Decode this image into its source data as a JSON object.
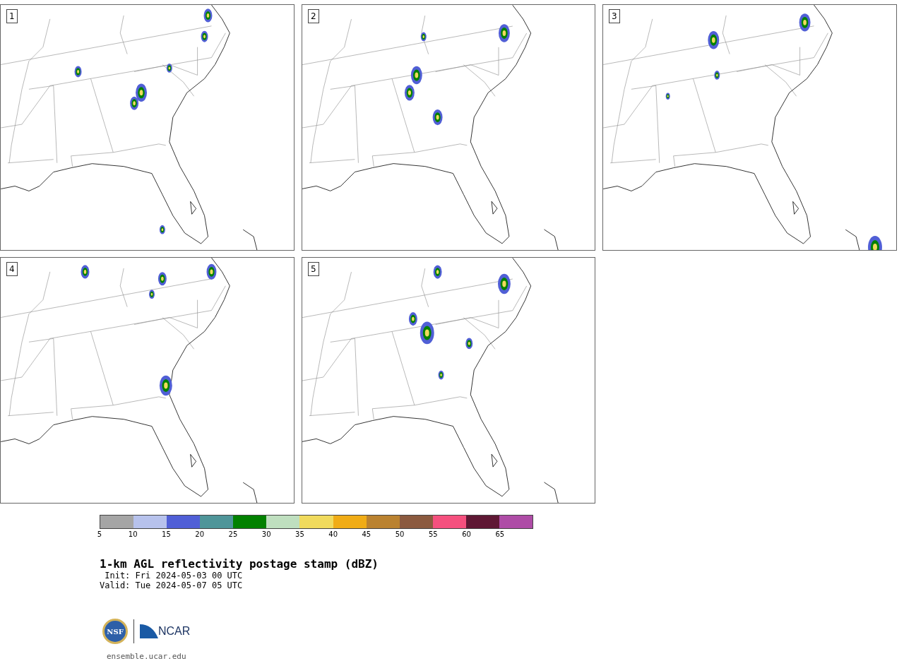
{
  "panels": [
    {
      "label": "1"
    },
    {
      "label": "2"
    },
    {
      "label": "3"
    },
    {
      "label": "4"
    },
    {
      "label": "5"
    }
  ],
  "colorbar": {
    "bins": [
      {
        "label": "5",
        "color": "#a5a5a5"
      },
      {
        "label": "10",
        "color": "#b7c2ec"
      },
      {
        "label": "15",
        "color": "#505fd6"
      },
      {
        "label": "20",
        "color": "#4f9599"
      },
      {
        "label": "25",
        "color": "#028100"
      },
      {
        "label": "30",
        "color": "#bfdfbf"
      },
      {
        "label": "35",
        "color": "#f0da5d"
      },
      {
        "label": "40",
        "color": "#f0ac16"
      },
      {
        "label": "45",
        "color": "#ba8230"
      },
      {
        "label": "50",
        "color": "#8b5a3f"
      },
      {
        "label": "55",
        "color": "#f5507e"
      },
      {
        "label": "60",
        "color": "#5f1834"
      },
      {
        "label": "65",
        "color": "#ae4ca6"
      }
    ]
  },
  "title": "1-km AGL reflectivity postage stamp (dBZ)",
  "init": " Init: Fri 2024-05-03 00 UTC",
  "valid": "Valid: Tue 2024-05-07 05 UTC",
  "logos": {
    "left": "NSF",
    "right": "NCAR"
  },
  "site": "ensemble.ucar.edu"
}
